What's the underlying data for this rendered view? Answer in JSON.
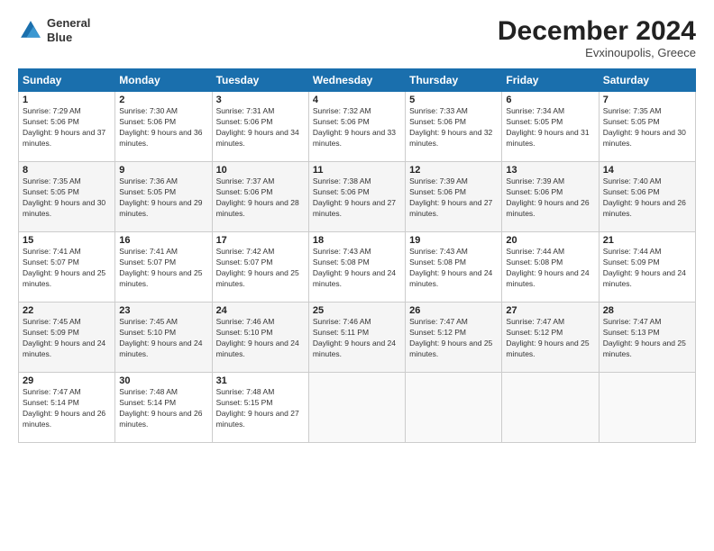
{
  "header": {
    "logo_line1": "General",
    "logo_line2": "Blue",
    "month_title": "December 2024",
    "location": "Evxinoupolis, Greece"
  },
  "days_of_week": [
    "Sunday",
    "Monday",
    "Tuesday",
    "Wednesday",
    "Thursday",
    "Friday",
    "Saturday"
  ],
  "weeks": [
    [
      {
        "day": "1",
        "sunrise": "Sunrise: 7:29 AM",
        "sunset": "Sunset: 5:06 PM",
        "daylight": "Daylight: 9 hours and 37 minutes."
      },
      {
        "day": "2",
        "sunrise": "Sunrise: 7:30 AM",
        "sunset": "Sunset: 5:06 PM",
        "daylight": "Daylight: 9 hours and 36 minutes."
      },
      {
        "day": "3",
        "sunrise": "Sunrise: 7:31 AM",
        "sunset": "Sunset: 5:06 PM",
        "daylight": "Daylight: 9 hours and 34 minutes."
      },
      {
        "day": "4",
        "sunrise": "Sunrise: 7:32 AM",
        "sunset": "Sunset: 5:06 PM",
        "daylight": "Daylight: 9 hours and 33 minutes."
      },
      {
        "day": "5",
        "sunrise": "Sunrise: 7:33 AM",
        "sunset": "Sunset: 5:06 PM",
        "daylight": "Daylight: 9 hours and 32 minutes."
      },
      {
        "day": "6",
        "sunrise": "Sunrise: 7:34 AM",
        "sunset": "Sunset: 5:05 PM",
        "daylight": "Daylight: 9 hours and 31 minutes."
      },
      {
        "day": "7",
        "sunrise": "Sunrise: 7:35 AM",
        "sunset": "Sunset: 5:05 PM",
        "daylight": "Daylight: 9 hours and 30 minutes."
      }
    ],
    [
      {
        "day": "8",
        "sunrise": "Sunrise: 7:35 AM",
        "sunset": "Sunset: 5:05 PM",
        "daylight": "Daylight: 9 hours and 30 minutes."
      },
      {
        "day": "9",
        "sunrise": "Sunrise: 7:36 AM",
        "sunset": "Sunset: 5:05 PM",
        "daylight": "Daylight: 9 hours and 29 minutes."
      },
      {
        "day": "10",
        "sunrise": "Sunrise: 7:37 AM",
        "sunset": "Sunset: 5:06 PM",
        "daylight": "Daylight: 9 hours and 28 minutes."
      },
      {
        "day": "11",
        "sunrise": "Sunrise: 7:38 AM",
        "sunset": "Sunset: 5:06 PM",
        "daylight": "Daylight: 9 hours and 27 minutes."
      },
      {
        "day": "12",
        "sunrise": "Sunrise: 7:39 AM",
        "sunset": "Sunset: 5:06 PM",
        "daylight": "Daylight: 9 hours and 27 minutes."
      },
      {
        "day": "13",
        "sunrise": "Sunrise: 7:39 AM",
        "sunset": "Sunset: 5:06 PM",
        "daylight": "Daylight: 9 hours and 26 minutes."
      },
      {
        "day": "14",
        "sunrise": "Sunrise: 7:40 AM",
        "sunset": "Sunset: 5:06 PM",
        "daylight": "Daylight: 9 hours and 26 minutes."
      }
    ],
    [
      {
        "day": "15",
        "sunrise": "Sunrise: 7:41 AM",
        "sunset": "Sunset: 5:07 PM",
        "daylight": "Daylight: 9 hours and 25 minutes."
      },
      {
        "day": "16",
        "sunrise": "Sunrise: 7:41 AM",
        "sunset": "Sunset: 5:07 PM",
        "daylight": "Daylight: 9 hours and 25 minutes."
      },
      {
        "day": "17",
        "sunrise": "Sunrise: 7:42 AM",
        "sunset": "Sunset: 5:07 PM",
        "daylight": "Daylight: 9 hours and 25 minutes."
      },
      {
        "day": "18",
        "sunrise": "Sunrise: 7:43 AM",
        "sunset": "Sunset: 5:08 PM",
        "daylight": "Daylight: 9 hours and 24 minutes."
      },
      {
        "day": "19",
        "sunrise": "Sunrise: 7:43 AM",
        "sunset": "Sunset: 5:08 PM",
        "daylight": "Daylight: 9 hours and 24 minutes."
      },
      {
        "day": "20",
        "sunrise": "Sunrise: 7:44 AM",
        "sunset": "Sunset: 5:08 PM",
        "daylight": "Daylight: 9 hours and 24 minutes."
      },
      {
        "day": "21",
        "sunrise": "Sunrise: 7:44 AM",
        "sunset": "Sunset: 5:09 PM",
        "daylight": "Daylight: 9 hours and 24 minutes."
      }
    ],
    [
      {
        "day": "22",
        "sunrise": "Sunrise: 7:45 AM",
        "sunset": "Sunset: 5:09 PM",
        "daylight": "Daylight: 9 hours and 24 minutes."
      },
      {
        "day": "23",
        "sunrise": "Sunrise: 7:45 AM",
        "sunset": "Sunset: 5:10 PM",
        "daylight": "Daylight: 9 hours and 24 minutes."
      },
      {
        "day": "24",
        "sunrise": "Sunrise: 7:46 AM",
        "sunset": "Sunset: 5:10 PM",
        "daylight": "Daylight: 9 hours and 24 minutes."
      },
      {
        "day": "25",
        "sunrise": "Sunrise: 7:46 AM",
        "sunset": "Sunset: 5:11 PM",
        "daylight": "Daylight: 9 hours and 24 minutes."
      },
      {
        "day": "26",
        "sunrise": "Sunrise: 7:47 AM",
        "sunset": "Sunset: 5:12 PM",
        "daylight": "Daylight: 9 hours and 25 minutes."
      },
      {
        "day": "27",
        "sunrise": "Sunrise: 7:47 AM",
        "sunset": "Sunset: 5:12 PM",
        "daylight": "Daylight: 9 hours and 25 minutes."
      },
      {
        "day": "28",
        "sunrise": "Sunrise: 7:47 AM",
        "sunset": "Sunset: 5:13 PM",
        "daylight": "Daylight: 9 hours and 25 minutes."
      }
    ],
    [
      {
        "day": "29",
        "sunrise": "Sunrise: 7:47 AM",
        "sunset": "Sunset: 5:14 PM",
        "daylight": "Daylight: 9 hours and 26 minutes."
      },
      {
        "day": "30",
        "sunrise": "Sunrise: 7:48 AM",
        "sunset": "Sunset: 5:14 PM",
        "daylight": "Daylight: 9 hours and 26 minutes."
      },
      {
        "day": "31",
        "sunrise": "Sunrise: 7:48 AM",
        "sunset": "Sunset: 5:15 PM",
        "daylight": "Daylight: 9 hours and 27 minutes."
      },
      null,
      null,
      null,
      null
    ]
  ]
}
